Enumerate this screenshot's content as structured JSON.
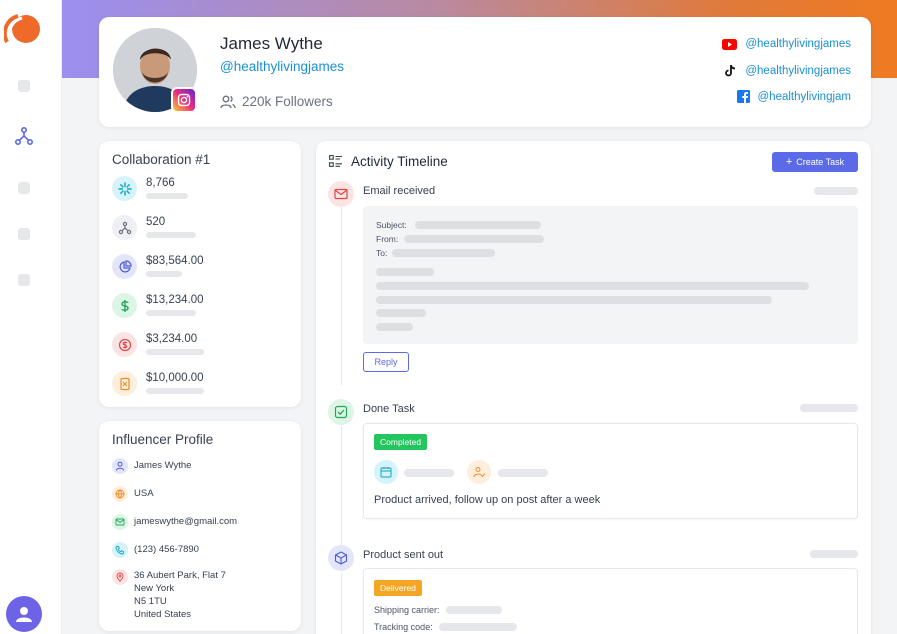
{
  "profile": {
    "name": "James Wythe",
    "handle": "@healthylivingjames",
    "followers": "220k Followers",
    "socials": [
      {
        "platform": "youtube-icon",
        "handle": "@healthylivingjames",
        "color": "#ff0000"
      },
      {
        "platform": "tiktok-icon",
        "handle": "@healthylivingjames",
        "color": "#111111"
      },
      {
        "platform": "facebook-icon",
        "handle": "@healthylivingjam",
        "color": "#1877f2"
      }
    ]
  },
  "collaboration": {
    "title": "Collaboration #1",
    "stats": [
      {
        "value": "8,766",
        "icon": "sparkle-icon",
        "color": "#0ea5c6",
        "bg": "#d6f3f9"
      },
      {
        "value": "520",
        "icon": "network-icon",
        "color": "#6b7280",
        "bg": "#eef0f3"
      },
      {
        "value": "$83,564.00",
        "icon": "pie-chart-icon",
        "color": "#4f5bd5",
        "bg": "#e3e6fb"
      },
      {
        "value": "$13,234.00",
        "icon": "dollar-icon",
        "color": "#22a55a",
        "bg": "#dcf5e5"
      },
      {
        "value": "$3,234.00",
        "icon": "dollar-circle-icon",
        "color": "#e04444",
        "bg": "#fde4e4"
      },
      {
        "value": "$10,000.00",
        "icon": "receipt-icon",
        "color": "#f08a24",
        "bg": "#fdeedd"
      }
    ]
  },
  "influencer": {
    "title": "Influencer Profile",
    "name": "James Wythe",
    "country": "USA",
    "email": "jameswythe@gmail.com",
    "phone": "(123) 456-7890",
    "address": [
      "36 Aubert Park, Flat 7",
      "New York",
      "N5 1TU",
      "United States"
    ]
  },
  "timeline": {
    "title": "Activity Timeline",
    "create_label": "Create Task",
    "email_label": "Email received",
    "subject_label": "Subject:",
    "from_label": "From:",
    "to_label": "To:",
    "reply_label": "Reply",
    "done_label": "Done Task",
    "completed_badge": "Completed",
    "task_text": "Product arrived, follow up on post after a week",
    "sent_label": "Product sent out",
    "delivered_badge": "Delivered",
    "carrier_label": "Shipping carrier:",
    "tracking_label": "Tracking code:"
  },
  "colors": {
    "accent": "#5b6ae6",
    "completed": "#22c55e",
    "delivered": "#f5a524"
  }
}
